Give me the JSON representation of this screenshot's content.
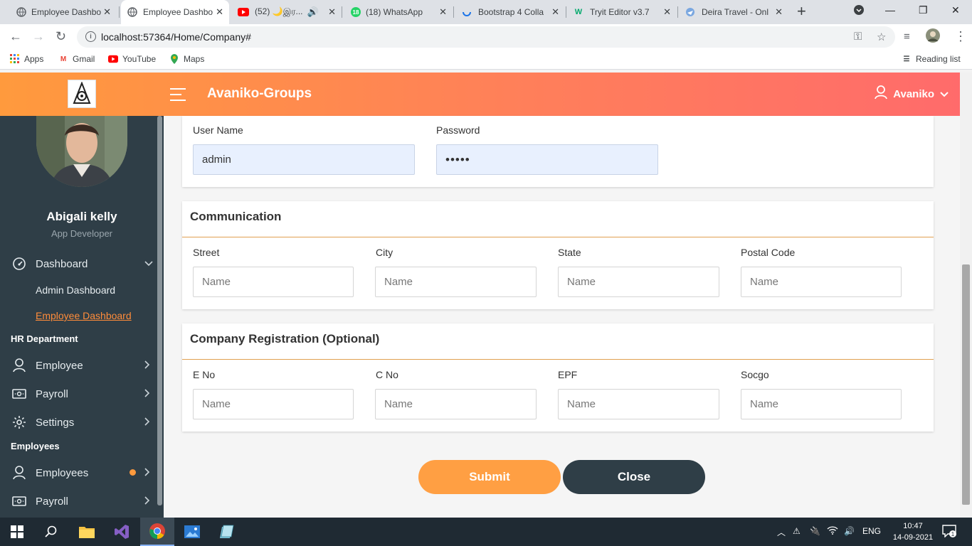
{
  "browser": {
    "tabs": [
      {
        "label": "Employee Dashbo",
        "icon": "globe-icon"
      },
      {
        "label": "Employee Dashbo",
        "icon": "globe-icon",
        "active": true
      },
      {
        "label": "(52) 🌙இர...",
        "icon": "youtube-icon"
      },
      {
        "label": "(18) WhatsApp",
        "icon": "whatsapp-icon"
      },
      {
        "label": "Bootstrap 4 Colla",
        "icon": "loading-icon"
      },
      {
        "label": "Tryit Editor v3.7",
        "icon": "w3schools-icon"
      },
      {
        "label": "Deira Travel - Onl",
        "icon": "travel-icon"
      }
    ],
    "url": "localhost:57364/Home/Company#",
    "bookmarks": [
      "Apps",
      "Gmail",
      "YouTube",
      "Maps"
    ],
    "reading_list": "Reading list"
  },
  "header": {
    "brand": "Avaniko-Groups",
    "user": "Avaniko"
  },
  "sidebar": {
    "profile_name": "Abigali kelly",
    "profile_role": "App Developer",
    "dashboard": "Dashboard",
    "admin_dashboard": "Admin Dashboard",
    "employee_dashboard": "Employee Dashboard",
    "hr_heading": "HR Department",
    "hr_employee": "Employee",
    "hr_payroll": "Payroll",
    "hr_settings": "Settings",
    "employees_heading": "Employees",
    "employees": "Employees",
    "payroll": "Payroll"
  },
  "login_card": {
    "username_label": "User Name",
    "username_value": "admin",
    "password_label": "Password",
    "password_value": "•••••"
  },
  "communication": {
    "title": "Communication",
    "street_label": "Street",
    "city_label": "City",
    "state_label": "State",
    "postal_label": "Postal Code",
    "placeholder": "Name"
  },
  "registration": {
    "title": "Company Registration (Optional)",
    "eno_label": "E No",
    "cno_label": "C No",
    "epf_label": "EPF",
    "socgo_label": "Socgo",
    "placeholder": "Name"
  },
  "actions": {
    "submit": "Submit",
    "close": "Close"
  },
  "taskbar": {
    "lang": "ENG",
    "time": "10:47",
    "date": "14-09-2021",
    "notifications": "1"
  }
}
